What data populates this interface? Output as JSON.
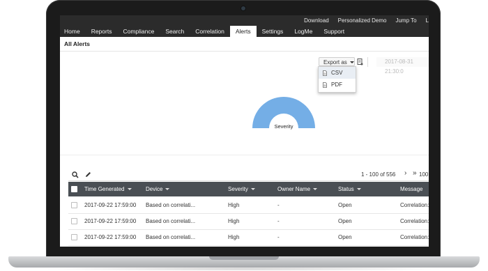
{
  "top_links": [
    "Download",
    "Personalized Demo",
    "Jump To",
    "L"
  ],
  "nav_tabs": [
    {
      "label": "Home"
    },
    {
      "label": "Reports"
    },
    {
      "label": "Compliance"
    },
    {
      "label": "Search"
    },
    {
      "label": "Correlation"
    },
    {
      "label": "Alerts"
    },
    {
      "label": "Settings"
    },
    {
      "label": "LogMe"
    },
    {
      "label": "Support"
    }
  ],
  "active_tab": "Alerts",
  "page": {
    "title": "All Alerts"
  },
  "toolbar": {
    "export_label": "Export as",
    "date_value": "2017-08-31 21:30:0"
  },
  "export_menu": {
    "items": [
      "CSV",
      "PDF"
    ]
  },
  "chart": {
    "label": "Severity",
    "color": "#74aee6"
  },
  "grid": {
    "pager": "1 - 100 of 556",
    "page_size": "100",
    "columns": [
      "Time Generated",
      "Device",
      "Severity",
      "Owner Name",
      "Status",
      "Message"
    ],
    "rows": [
      {
        "time": "2017-09-22 17:59:00",
        "device": "Based on correlati...",
        "severity": "High",
        "owner": "-",
        "status": "Open",
        "message": "Correlation:Li"
      },
      {
        "time": "2017-09-22 17:59:00",
        "device": "Based on correlati...",
        "severity": "High",
        "owner": "-",
        "status": "Open",
        "message": "Correlation:Li"
      },
      {
        "time": "2017-09-22 17:59:00",
        "device": "Based on correlati...",
        "severity": "High",
        "owner": "-",
        "status": "Open",
        "message": "Correlation:Li"
      }
    ]
  }
}
